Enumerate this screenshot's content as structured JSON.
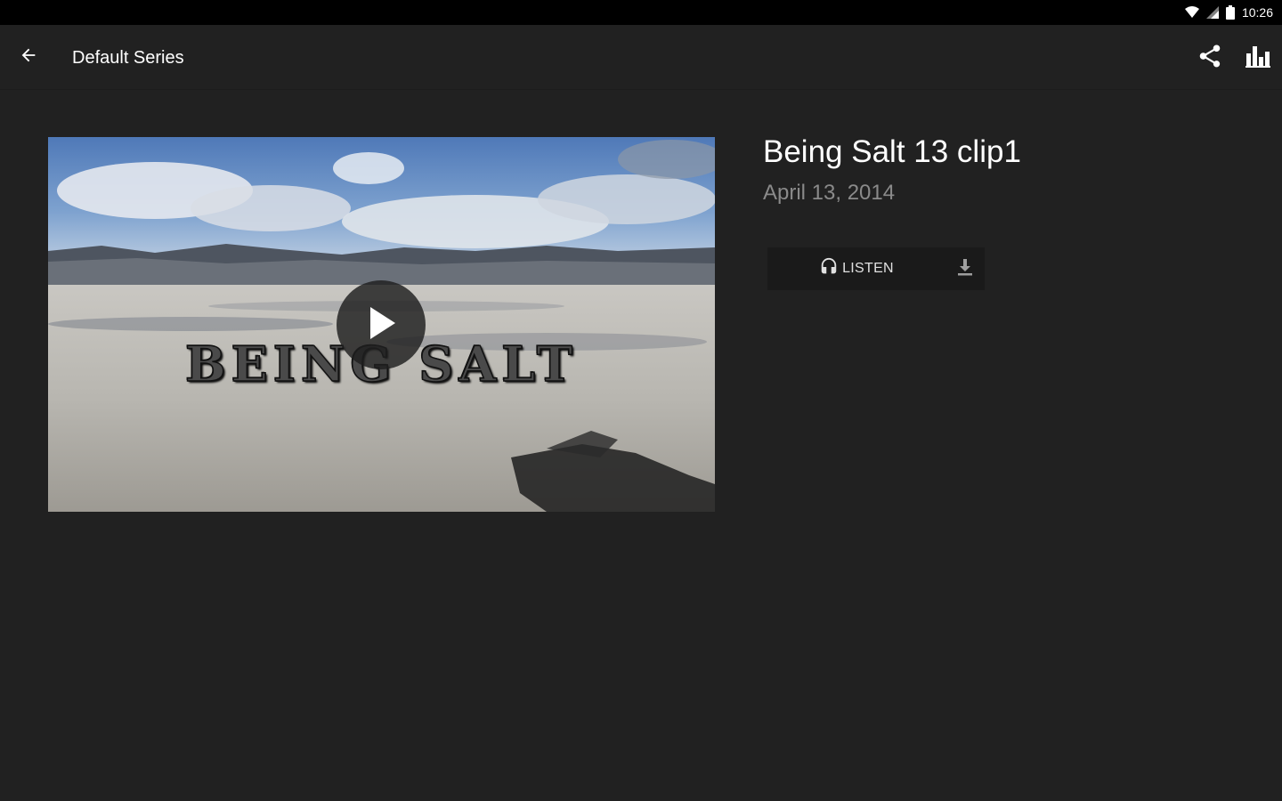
{
  "status_bar": {
    "time": "10:26",
    "icons": [
      "wifi-icon",
      "cellular-signal-icon",
      "battery-icon"
    ]
  },
  "toolbar": {
    "back_icon": "arrow-back-icon",
    "title": "Default Series",
    "actions": [
      "share-icon",
      "bar-chart-icon"
    ]
  },
  "video": {
    "overlay_text": "BEING SALT",
    "play_icon": "play-icon"
  },
  "episode": {
    "title": "Being Salt 13 clip1",
    "date": "April 13, 2014"
  },
  "actions": {
    "listen_label": "LISTEN",
    "listen_icon": "headphones-icon",
    "download_icon": "download-icon"
  },
  "colors": {
    "background": "#212121",
    "status_bar": "#000000",
    "secondary_text": "#8a8a8a",
    "action_bar": "#1a1a1a"
  }
}
